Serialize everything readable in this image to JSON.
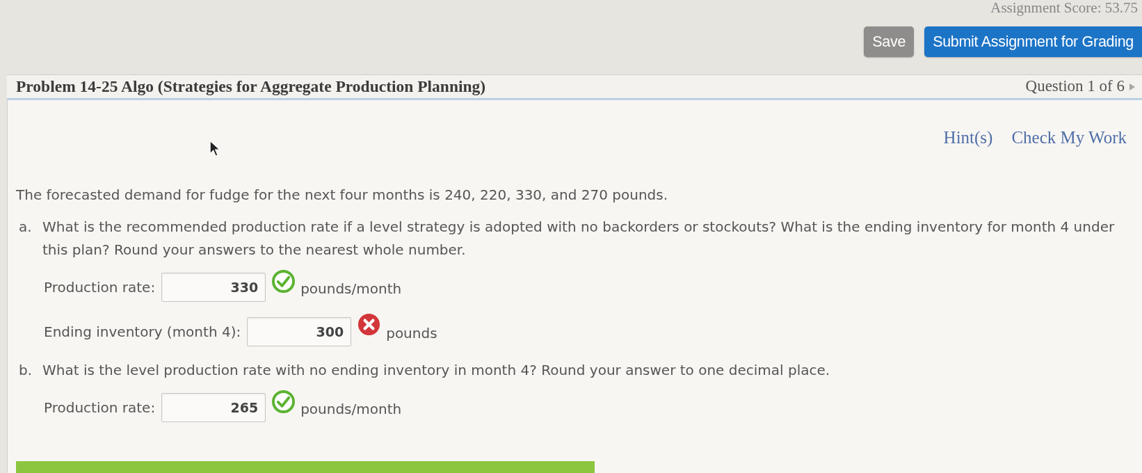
{
  "header": {
    "assignment_score": "Assignment Score: 53.75",
    "buttons": [
      {
        "label": "Save",
        "kind": "secondary"
      },
      {
        "label": "Submit Assignment for Grading",
        "kind": "primary"
      }
    ]
  },
  "problem_bar": {
    "title": "Problem 14-25 Algo (Strategies for Aggregate Production Planning)",
    "question_nav": "Question 1 of 6"
  },
  "links": [
    "Hint(s)",
    "Check My Work"
  ],
  "intro": "The forecasted demand for fudge for the next four months is 240, 220, 330, and 270 pounds.",
  "parts": [
    {
      "marker": "a.",
      "question": "What is the recommended production rate if a level strategy is adopted with no backorders or stockouts? What is the ending inventory for month 4 under this plan? Round your answers to the nearest whole number.",
      "answers": [
        {
          "label": "Production rate:",
          "value": "330",
          "correct": true,
          "unit": "pounds/month"
        },
        {
          "label": "Ending inventory (month 4):",
          "value": "300",
          "correct": false,
          "unit": "pounds"
        }
      ]
    },
    {
      "marker": "b.",
      "question": "What is the level production rate with no ending inventory in month 4? Round your answer to one decimal place.",
      "answers": [
        {
          "label": "Production rate:",
          "value": "265",
          "correct": true,
          "unit": "pounds/month"
        }
      ]
    }
  ]
}
